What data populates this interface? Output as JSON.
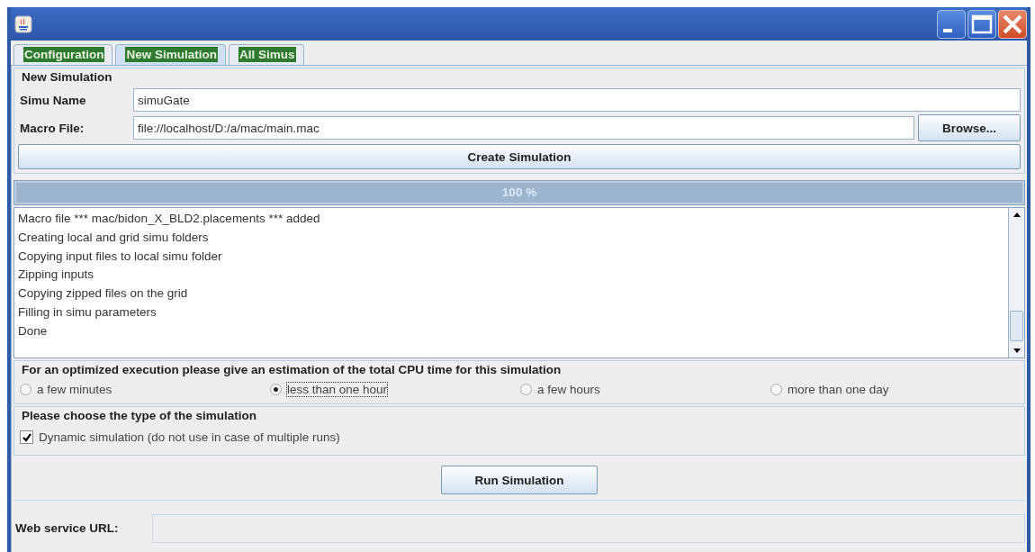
{
  "tabs": [
    {
      "label": "Configuration",
      "selected": false
    },
    {
      "label": "New Simulation",
      "selected": true
    },
    {
      "label": "All Simus",
      "selected": false
    }
  ],
  "new_simulation": {
    "title": "New Simulation",
    "fields": [
      {
        "label": "Simu Name",
        "value": "simuGate"
      },
      {
        "label": "Macro File:",
        "value": "file://localhost/D:/a/mac/main.mac",
        "button": "Browse..."
      }
    ],
    "create_button": "Create Simulation"
  },
  "progress": {
    "level": 1,
    "text": "100 %"
  },
  "log": [
    "Macro file *** mac/bidon_X_BLD2.placements *** added",
    "Creating local and grid simu folders",
    "Copying input files to local simu folder",
    "Zipping inputs",
    "Copying zipped files on the grid",
    "Filling in simu parameters",
    "Done"
  ],
  "cpu_time": {
    "title": "For an optimized execution please give an estimation of the total CPU time for this simulation",
    "options": [
      {
        "label": "a few minutes",
        "selected": false
      },
      {
        "label": "less than one hour",
        "selected": true
      },
      {
        "label": "a few hours",
        "selected": false
      },
      {
        "label": "more than one day",
        "selected": false
      }
    ]
  },
  "sim_type": {
    "title": "Please choose the type of the simulation",
    "checkbox": {
      "label": "Dynamic simulation (do not use in case of multiple runs)",
      "checked": true
    }
  },
  "run_button": "Run Simulation",
  "web_service": {
    "label": "Web service URL:"
  }
}
